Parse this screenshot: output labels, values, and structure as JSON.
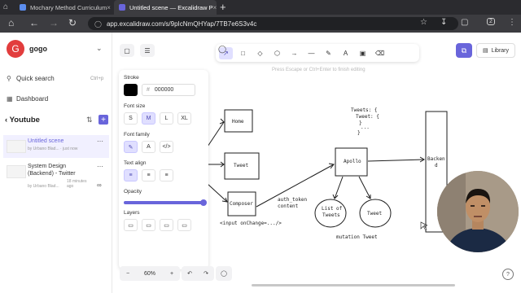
{
  "browser": {
    "tabs": [
      {
        "title": "Mochary Method Curriculum",
        "close": "×"
      },
      {
        "title": "Untitled scene — Excalidraw P",
        "close": "×"
      }
    ],
    "new_tab": "+",
    "url": "app.excalidraw.com/s/9pIcNmQHYap/7TB7e6S3v4c",
    "profile_badge": "2"
  },
  "sidebar": {
    "avatar_letter": "G",
    "workspace": "gogo",
    "quick_search": "Quick search",
    "quick_search_shortcut": "Ctrl+p",
    "dashboard": "Dashboard",
    "collection": "Youtube",
    "scenes": [
      {
        "name": "Untitled scene",
        "by": "by Urbano Blad... · just now"
      },
      {
        "name": "System Design (Backend) - Twitter",
        "by": "by Urbano Blad...",
        "time": "18 minutes ago"
      }
    ]
  },
  "canvas": {
    "hint": "Press Escape or Ctrl+Enter to finish editing",
    "library_label": "Library",
    "zoom": "60%",
    "properties": {
      "stroke_label": "Stroke",
      "stroke_hex": "000000",
      "font_size_label": "Font size",
      "font_sizes": [
        "S",
        "M",
        "L",
        "XL"
      ],
      "font_size_selected": "M",
      "font_family_label": "Font family",
      "text_align_label": "Text align",
      "opacity_label": "Opacity",
      "opacity_value": 1.0,
      "layers_label": "Layers"
    },
    "drawing_labels": {
      "home": "Home",
      "tweet1": "Tweet",
      "composer": "Composer",
      "input": "<input onChange=.../>",
      "auth": "auth_token",
      "content": "content",
      "apollo": "Apollo",
      "tweets_line1": "Tweets: {",
      "tweets_line2": "Tweet: {",
      "tweets_line3": "}",
      "tweets_line4": "...",
      "tweets_line5": "}",
      "list_line1": "List of",
      "list_line2": "Tweets",
      "tweet2": "Tweet",
      "mutation": "mutation Tweet",
      "backend_line1": "Backen",
      "backend_line2": "d"
    }
  },
  "colors": {
    "accent": "#6965db",
    "avatar": "#e23d3d",
    "selected_bg": "#e0dfff"
  }
}
